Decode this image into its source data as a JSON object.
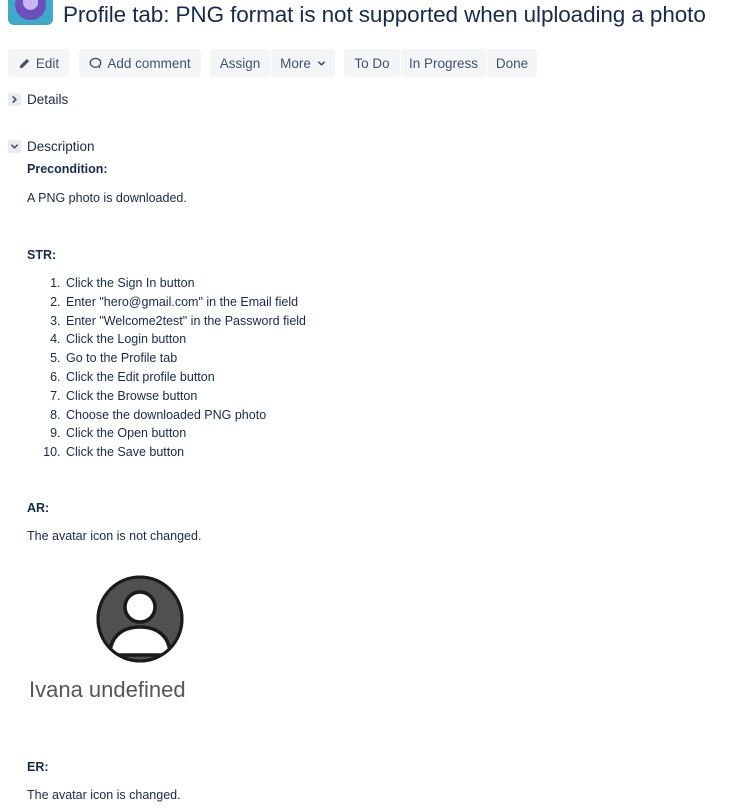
{
  "issue": {
    "title": "Profile tab: PNG format is not supported when ulploading a photo"
  },
  "toolbar": {
    "edit_label": "Edit",
    "comment_label": "Add comment",
    "assign_label": "Assign",
    "more_label": "More",
    "status_todo": "To Do",
    "status_inprogress": "In Progress",
    "status_done": "Done"
  },
  "sections": {
    "details_label": "Details",
    "description_label": "Description"
  },
  "description": {
    "precondition_heading": "Precondition:",
    "precondition_text": "A PNG photo is downloaded.",
    "str_heading": "STR:",
    "steps": [
      "Click the Sign In button",
      "Enter \"hero@gmail.com\" in the Email field",
      "Enter \"Welcome2test\" in the Password field",
      "Click the Login button",
      "Go to the Profile tab",
      "Click the Edit profile button",
      "Click the Browse button",
      "Choose the downloaded PNG photo",
      "Click the Open button",
      "Click the Save button"
    ],
    "ar_heading": "AR:",
    "ar_text": "The avatar icon is not changed.",
    "avatar_name": "Ivana undefined",
    "er_heading": "ER:",
    "er_text": "The avatar icon is changed."
  },
  "icons": {
    "edit": "pencil-icon",
    "comment": "speech-bubble-icon",
    "more": "chevron-down-icon",
    "details": "chevron-right-icon",
    "description": "chevron-down-icon",
    "avatar": "user-avatar-icon"
  }
}
